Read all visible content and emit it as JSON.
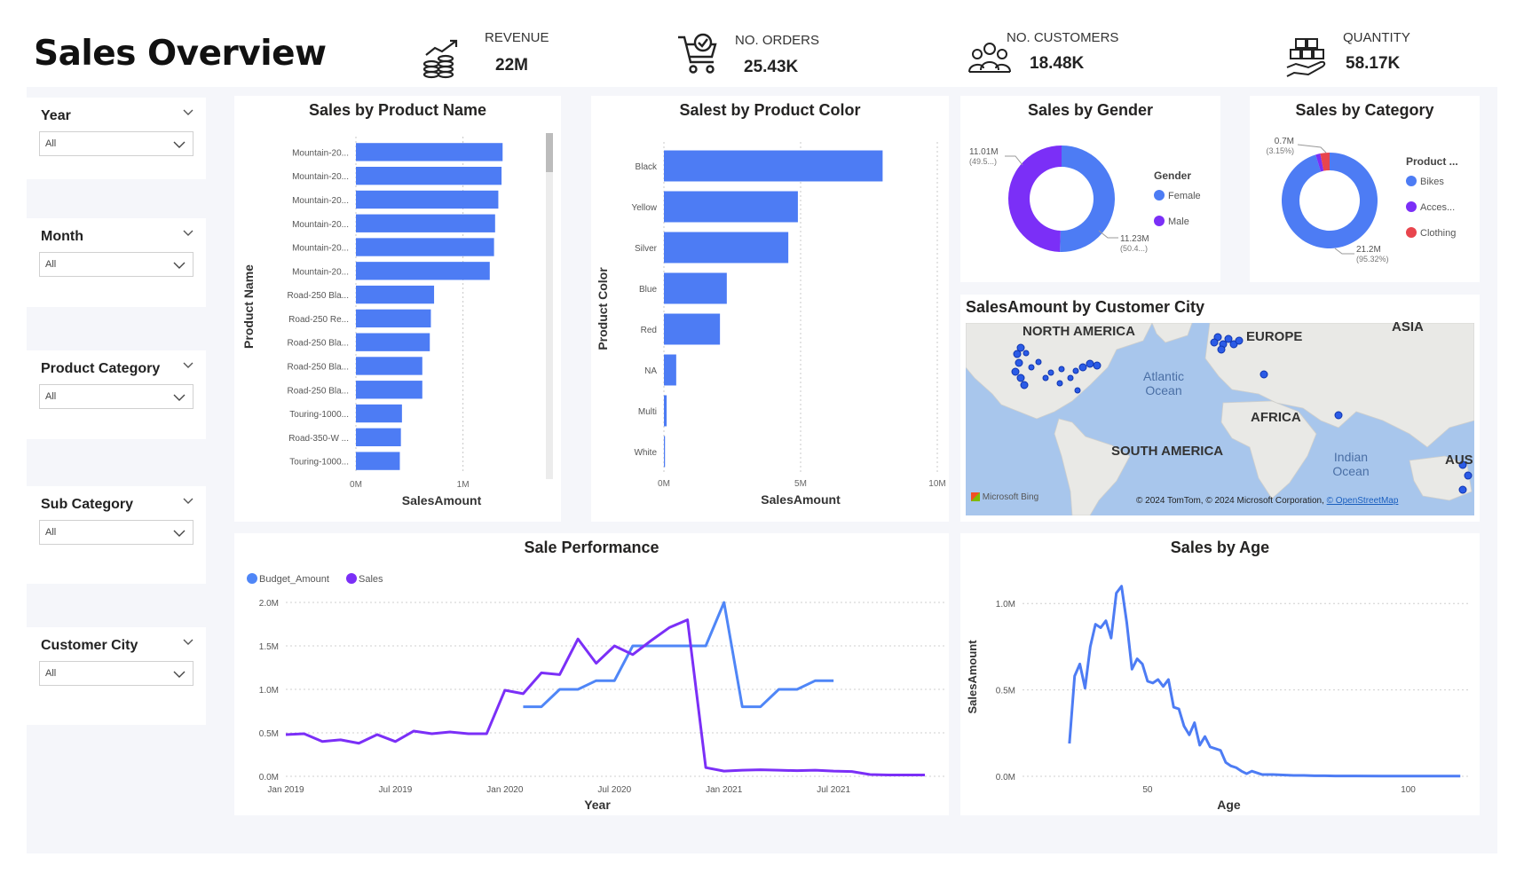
{
  "title": "Sales Overview",
  "kpis": [
    {
      "label": "REVENUE",
      "value": "22M",
      "icon": "revenue-icon"
    },
    {
      "label": "NO. ORDERS",
      "value": "25.43K",
      "icon": "cart-icon"
    },
    {
      "label": "NO. CUSTOMERS",
      "value": "18.48K",
      "icon": "customers-icon"
    },
    {
      "label": "QUANTITY",
      "value": "58.17K",
      "icon": "quantity-icon"
    }
  ],
  "slicers": [
    {
      "title": "Year",
      "value": "All"
    },
    {
      "title": "Month",
      "value": "All"
    },
    {
      "title": "Product Category",
      "value": "All"
    },
    {
      "title": "Sub Category",
      "value": "All"
    },
    {
      "title": "Customer City",
      "value": "All"
    }
  ],
  "colors": {
    "blue": "#4d7cf4",
    "purple": "#7b2ff7",
    "red": "#e8454d",
    "budget": "#4f86f7"
  },
  "chart_data": [
    {
      "id": "product-name",
      "type": "bar",
      "title": "Sales by Product Name",
      "xlabel": "SalesAmount",
      "ylabel": "Product Name",
      "categories": [
        "Mountain-20...",
        "Mountain-20...",
        "Mountain-20...",
        "Mountain-20...",
        "Mountain-20...",
        "Mountain-20...",
        "Road-250 Bla...",
        "Road-250 Re...",
        "Road-250 Bla...",
        "Road-250 Bla...",
        "Road-250 Bla...",
        "Touring-1000...",
        "Road-350-W ...",
        "Touring-1000..."
      ],
      "values": [
        1370000,
        1360000,
        1330000,
        1300000,
        1290000,
        1250000,
        730000,
        700000,
        690000,
        620000,
        620000,
        430000,
        420000,
        410000
      ],
      "xlim": [
        0,
        1600000
      ],
      "xticks": [
        {
          "v": 0,
          "label": "0M"
        },
        {
          "v": 1000000,
          "label": "1M"
        }
      ]
    },
    {
      "id": "product-color",
      "type": "bar",
      "title": "Salest by Product Color",
      "xlabel": "SalesAmount",
      "ylabel": "Product Color",
      "categories": [
        "Black",
        "Yellow",
        "Silver",
        "Blue",
        "Red",
        "NA",
        "Multi",
        "White"
      ],
      "values": [
        8000000,
        4900000,
        4550000,
        2300000,
        2050000,
        450000,
        100000,
        40000
      ],
      "xlim": [
        0,
        10000000
      ],
      "xticks": [
        {
          "v": 0,
          "label": "0M"
        },
        {
          "v": 5000000,
          "label": "5M"
        },
        {
          "v": 10000000,
          "label": "10M"
        }
      ]
    },
    {
      "id": "gender",
      "type": "pie",
      "title": "Sales by Gender",
      "legend_title": "Gender",
      "slices": [
        {
          "name": "Female",
          "value": 11.23,
          "label": "11.23M",
          "sub": "(50.4...)"
        },
        {
          "name": "Male",
          "value": 11.01,
          "label": "11.01M",
          "sub": "(49.5...)"
        }
      ]
    },
    {
      "id": "category",
      "type": "pie",
      "title": "Sales by Category",
      "legend_title": "Product ...",
      "slices": [
        {
          "name": "Bikes",
          "value": 21.2,
          "label": "21.2M",
          "sub": "(95.32%)"
        },
        {
          "name": "Acces...",
          "value": 0.35,
          "label": "",
          "sub": ""
        },
        {
          "name": "Clothing",
          "value": 0.7,
          "label": "0.7M",
          "sub": "(3.15%)"
        }
      ]
    },
    {
      "id": "performance",
      "type": "line",
      "title": "Sale Performance",
      "xlabel": "Year",
      "ylabel": "",
      "x_ticks": [
        "Jan 2019",
        "Jul 2019",
        "Jan 2020",
        "Jul 2020",
        "Jan 2021",
        "Jul 2021"
      ],
      "y_ticks": [
        "0.0M",
        "0.5M",
        "1.0M",
        "1.5M",
        "2.0M"
      ],
      "ylim": [
        0,
        2000000
      ],
      "series": [
        {
          "name": "Budget_Amount",
          "start_month": 13,
          "values": [
            800000,
            800000,
            1000000,
            1000000,
            1100000,
            1100000,
            1500000,
            1500000,
            1500000,
            1500000,
            1500000,
            2000000,
            800000,
            800000,
            1000000,
            1000000,
            1100000,
            1100000
          ]
        },
        {
          "name": "Sales",
          "start_month": 0,
          "values": [
            480000,
            490000,
            400000,
            420000,
            380000,
            480000,
            400000,
            520000,
            490000,
            510000,
            490000,
            490000,
            990000,
            950000,
            1190000,
            1170000,
            1580000,
            1300000,
            1500000,
            1400000,
            1560000,
            1710000,
            1800000,
            100000,
            60000,
            70000,
            75000,
            70000,
            65000,
            70000,
            60000,
            55000,
            20000,
            15000,
            15000,
            15000
          ]
        }
      ],
      "x_months_total": 36
    },
    {
      "id": "age",
      "type": "line",
      "title": "Sales by Age",
      "xlabel": "Age",
      "ylabel": "SalesAmount",
      "xlim": [
        26,
        112
      ],
      "ylim": [
        0,
        1150000
      ],
      "xticks": [
        {
          "v": 50,
          "label": "50"
        },
        {
          "v": 100,
          "label": "100"
        }
      ],
      "yticks": [
        {
          "v": 0,
          "label": "0.0M"
        },
        {
          "v": 500000,
          "label": "0.5M"
        },
        {
          "v": 1000000,
          "label": "1.0M"
        }
      ],
      "x": [
        35,
        36,
        37,
        38,
        39,
        40,
        41,
        42,
        43,
        44,
        45,
        46,
        47,
        48,
        49,
        50,
        51,
        52,
        53,
        54,
        55,
        56,
        57,
        58,
        59,
        60,
        61,
        62,
        63,
        64,
        65,
        66,
        67,
        68,
        69,
        70,
        72,
        74,
        76,
        78,
        80,
        82,
        84,
        86,
        88,
        90,
        95,
        100,
        105,
        110
      ],
      "values": [
        190000,
        580000,
        650000,
        510000,
        750000,
        880000,
        860000,
        900000,
        800000,
        1060000,
        1100000,
        890000,
        620000,
        680000,
        650000,
        550000,
        540000,
        560000,
        520000,
        560000,
        400000,
        390000,
        290000,
        240000,
        310000,
        180000,
        230000,
        170000,
        160000,
        150000,
        80000,
        60000,
        50000,
        30000,
        15000,
        30000,
        10000,
        10000,
        8000,
        5000,
        5000,
        3000,
        3000,
        2000,
        2000,
        2000,
        1000,
        1000,
        1000,
        1000
      ]
    }
  ],
  "map": {
    "title": "SalesAmount by Customer City",
    "labels": [
      "NORTH AMERICA",
      "EUROPE",
      "ASIA",
      "Atlantic Ocean",
      "AFRICA",
      "SOUTH AMERICA",
      "Indian Ocean",
      "AUS"
    ],
    "brand": "Microsoft Bing",
    "credits": "© 2024 TomTom, © 2024 Microsoft Corporation,",
    "credits_link": "© OpenStreetMap"
  }
}
